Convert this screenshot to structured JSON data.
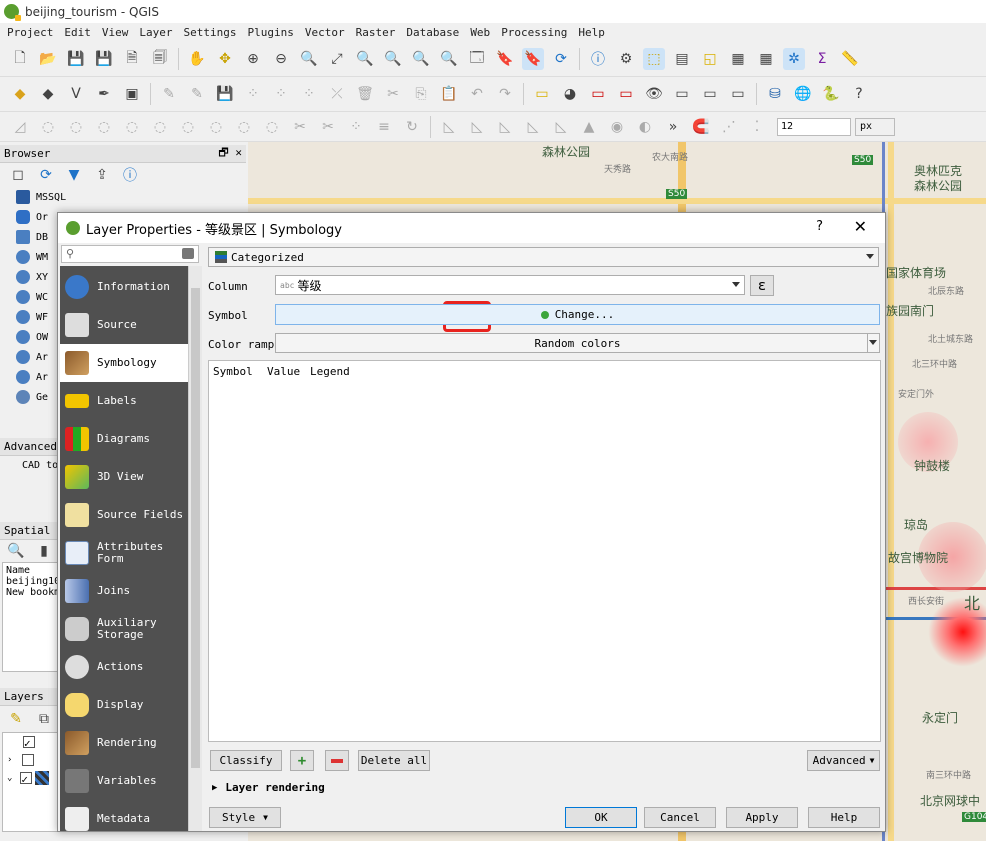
{
  "window": {
    "title": "beijing_tourism - QGIS"
  },
  "menu": [
    "Project",
    "Edit",
    "View",
    "Layer",
    "Settings",
    "Plugins",
    "Vector",
    "Raster",
    "Database",
    "Web",
    "Processing",
    "Help"
  ],
  "browser": {
    "title": "Browser",
    "items": [
      "MSSQL",
      "Or",
      "DB",
      "WM",
      "XY",
      "WC",
      "WF",
      "OW",
      "Ar",
      "Ar",
      "Ge"
    ]
  },
  "advanced": {
    "title": "Advanced",
    "text": "CAD to"
  },
  "spatial": {
    "title": "Spatial B",
    "col": "Name",
    "rows": [
      "beijing10",
      "New bookm"
    ]
  },
  "layers": {
    "title": "Layers"
  },
  "map": {
    "labels": [
      "森林公园",
      "天秀路",
      "农大南路",
      "奥林匹克",
      "森林公园",
      "国家体育场",
      "北辰东路",
      "族园南门",
      "北土城东路",
      "安定门外",
      "北三环中路",
      "钟鼓楼",
      "琼岛",
      "故宫博物院",
      "西长安街",
      "北",
      "永定门",
      "南三环中路",
      "北京网球中",
      "S50",
      "S50",
      "G104"
    ],
    "zoom": "12",
    "unit": "px"
  },
  "dialog": {
    "title": "Layer Properties - 等级景区 | Symbology",
    "help": "?",
    "nav": [
      {
        "label": "Information",
        "icon": "info-icon"
      },
      {
        "label": "Source",
        "icon": "wrench-icon"
      },
      {
        "label": "Symbology",
        "icon": "paintbrush-icon"
      },
      {
        "label": "Labels",
        "icon": "labels-icon"
      },
      {
        "label": "Diagrams",
        "icon": "diagram-icon"
      },
      {
        "label": "3D View",
        "icon": "cube-icon"
      },
      {
        "label": "Source Fields",
        "icon": "fields-icon"
      },
      {
        "label": "Attributes Form",
        "icon": "form-icon"
      },
      {
        "label": "Joins",
        "icon": "joins-icon"
      },
      {
        "label": "Auxiliary Storage",
        "icon": "database-icon"
      },
      {
        "label": "Actions",
        "icon": "actions-icon"
      },
      {
        "label": "Display",
        "icon": "display-icon"
      },
      {
        "label": "Rendering",
        "icon": "rendering-icon"
      },
      {
        "label": "Variables",
        "icon": "variables-icon"
      },
      {
        "label": "Metadata",
        "icon": "metadata-icon"
      }
    ],
    "renderer": "Categorized",
    "column_label": "Column",
    "column_value": "等级",
    "column_badge": "abc",
    "symbol_label": "Symbol",
    "symbol_button": "Change...",
    "ramp_label": "Color ramp",
    "ramp_value": "Random colors",
    "headers": [
      "Symbol",
      "Value",
      "Legend"
    ],
    "buttons": {
      "classify": "Classify",
      "delete_all": "Delete all",
      "advanced": "Advanced",
      "layer_rendering": "Layer rendering",
      "style": "Style",
      "ok": "OK",
      "cancel": "Cancel",
      "apply": "Apply",
      "help": "Help"
    },
    "colors": {
      "highlight": "#e8231e",
      "nav_bg": "#505050"
    }
  }
}
